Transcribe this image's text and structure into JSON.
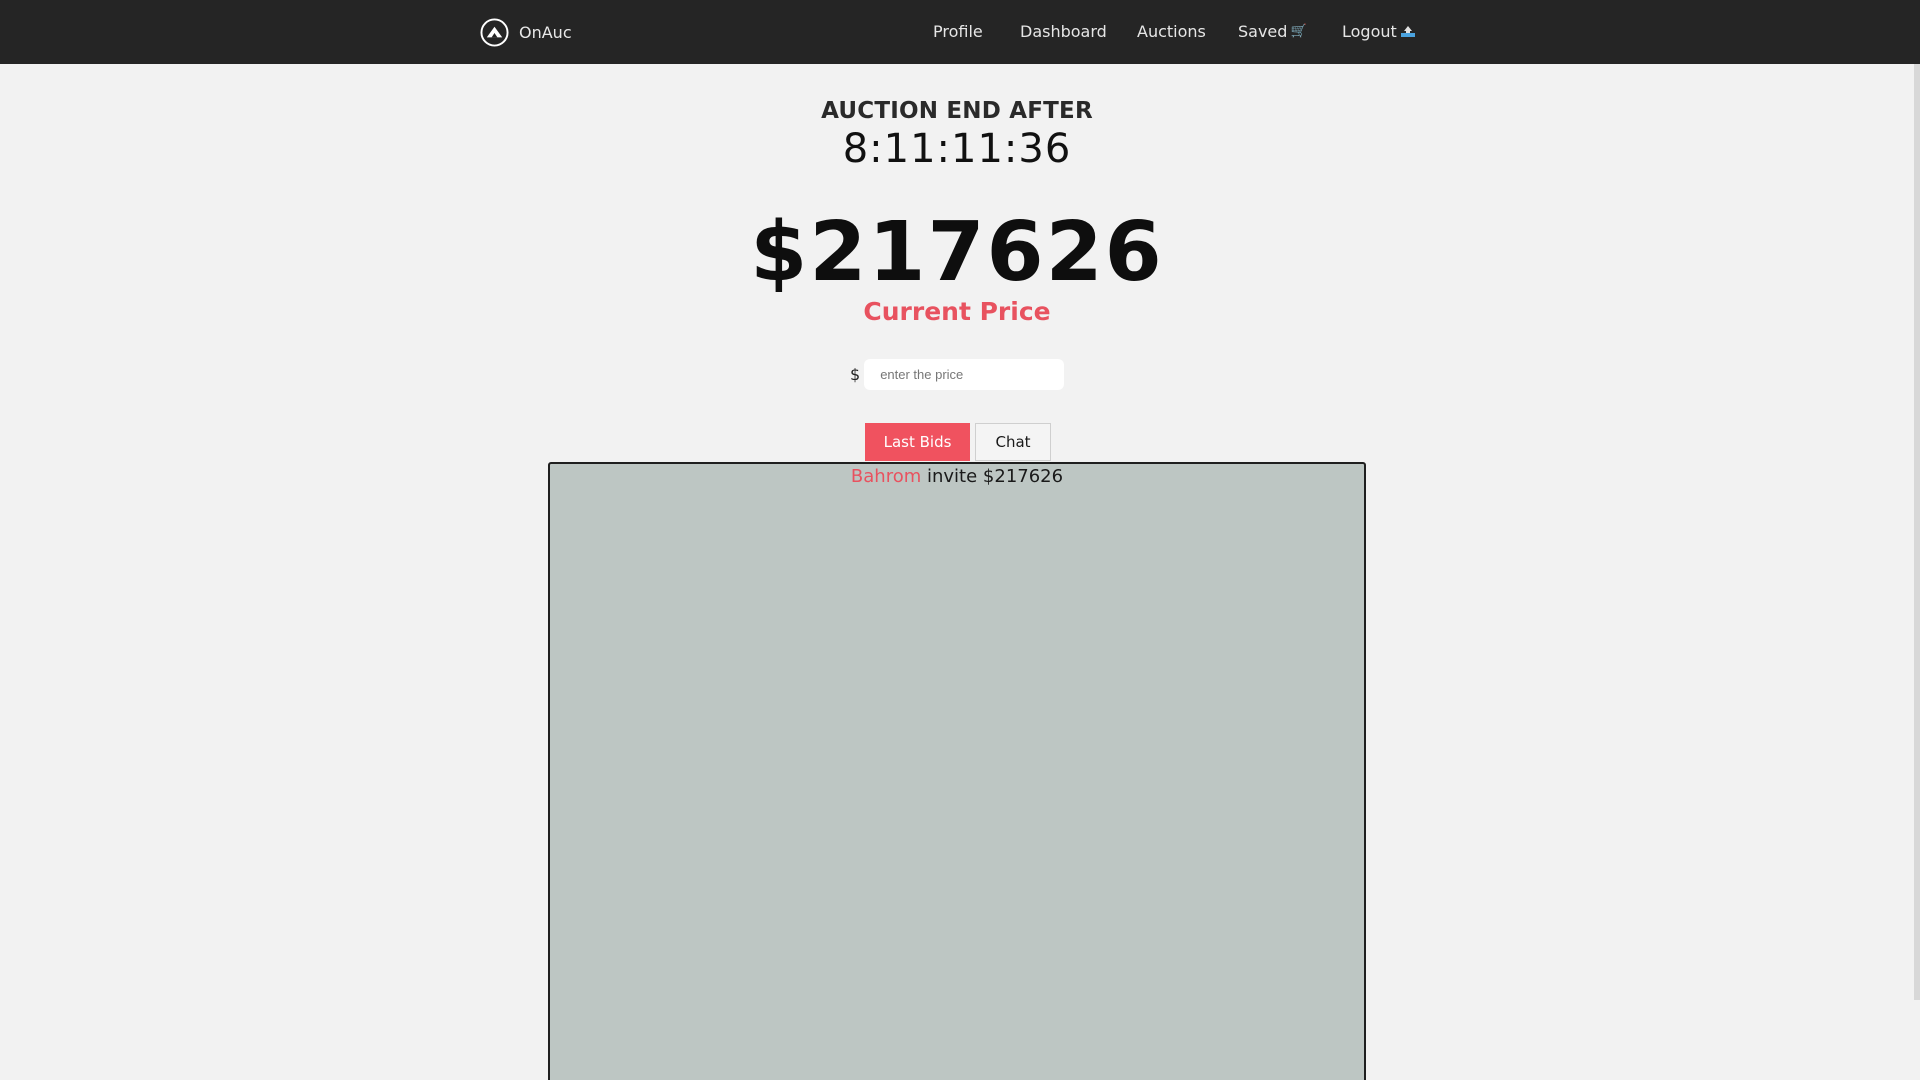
{
  "brand": {
    "name": "OnAuc",
    "logo_icon": "mountain-logo-icon"
  },
  "nav": {
    "profile": "Profile",
    "dashboard": "Dashboard",
    "auctions": "Auctions",
    "saved": "Saved",
    "saved_icon": "🛒",
    "logout": "Logout",
    "logout_icon": "⏏"
  },
  "auction": {
    "end_label": "AUCTION END AFTER",
    "countdown": "8:11:11:36",
    "current_price": "$217626",
    "current_price_label": "Current Price"
  },
  "bid_form": {
    "currency_symbol": "$",
    "placeholder": "enter the price",
    "value": ""
  },
  "tabs": {
    "last_bids": "Last Bids",
    "chat": "Chat",
    "active": "last_bids"
  },
  "last_bids": [
    {
      "bidder": "Bahrom",
      "action": "invite",
      "amount": "$217626"
    }
  ],
  "colors": {
    "accent": "#f0525f",
    "navbar": "#252525",
    "background": "#f2f2f2",
    "panel": "#bdc6c3"
  }
}
